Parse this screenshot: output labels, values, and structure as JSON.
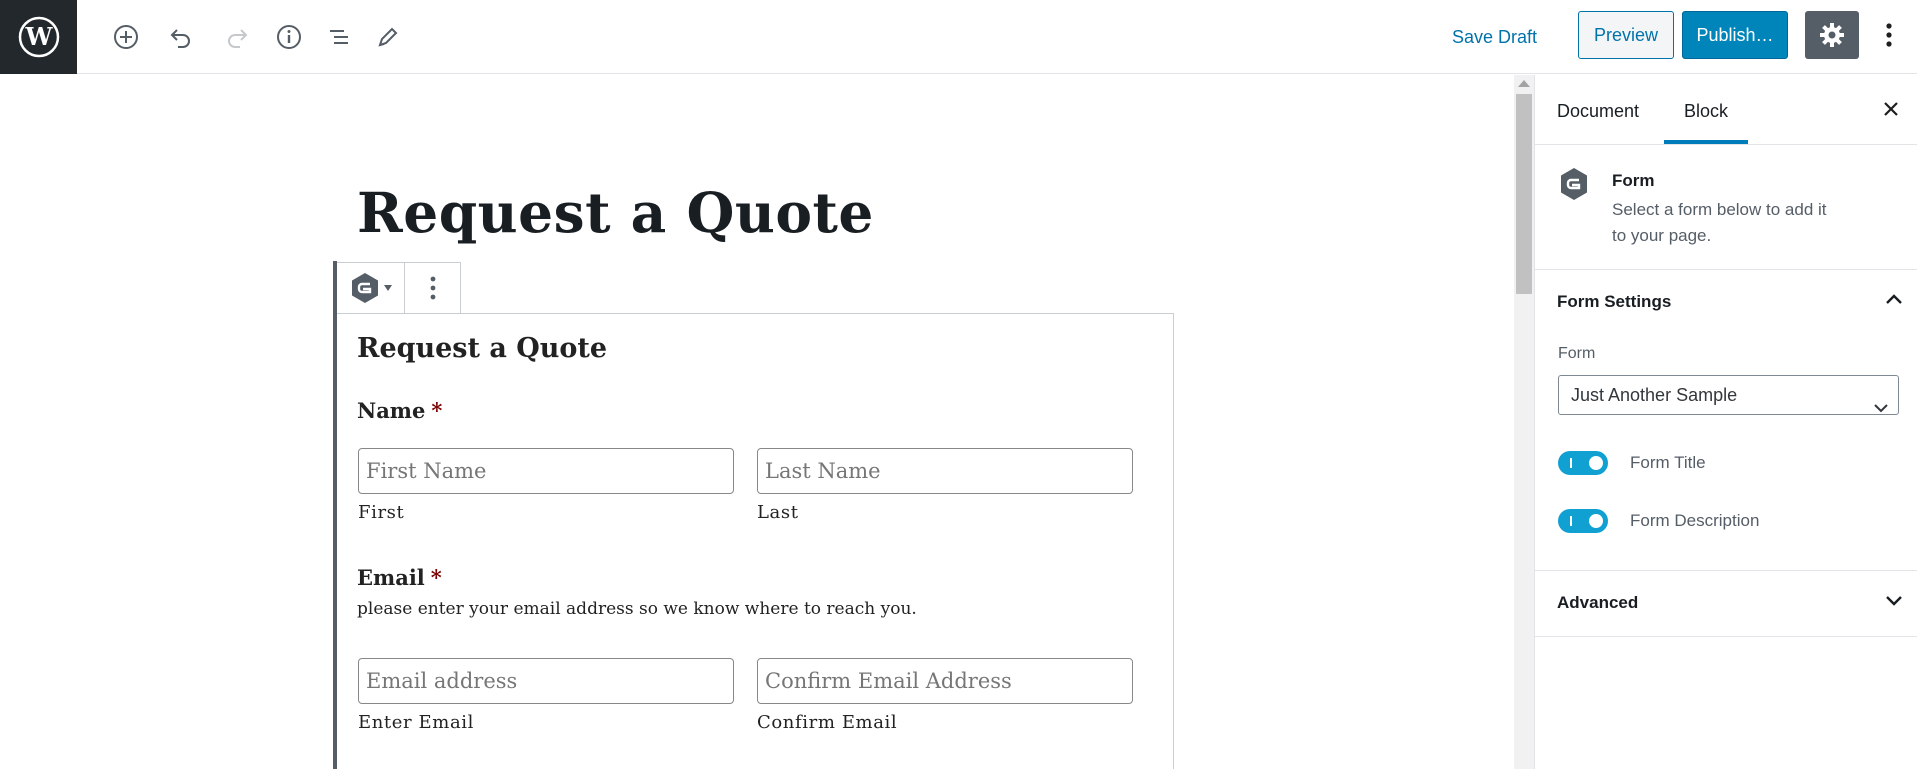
{
  "toolbar": {
    "save_draft_label": "Save Draft",
    "preview_label": "Preview",
    "publish_label": "Publish…",
    "accent_color": "#0073aa",
    "publish_color": "#0085ba"
  },
  "editor": {
    "post_title": "Request a Quote",
    "form": {
      "title": "Request a Quote",
      "name_label": "Name",
      "required_mark": "*",
      "first_name_placeholder": "First Name",
      "first_sublabel": "First",
      "last_name_placeholder": "Last Name",
      "last_sublabel": "Last",
      "email_label": "Email",
      "email_description": "please enter your email address so we know where to reach you.",
      "email_placeholder": "Email address",
      "enter_email_sublabel": "Enter Email",
      "confirm_email_placeholder": "Confirm Email Address",
      "confirm_email_sublabel": "Confirm Email"
    }
  },
  "sidebar": {
    "tabs": [
      {
        "label": "Document",
        "active": false
      },
      {
        "label": "Block",
        "active": true
      }
    ],
    "block_card": {
      "title": "Form",
      "description": "Select a form below to add it to your page."
    },
    "form_settings": {
      "title": "Form Settings",
      "expanded": true,
      "form_select_label": "Form",
      "form_select_value": "Just Another Sample",
      "toggles": [
        {
          "label": "Form Title",
          "on": true
        },
        {
          "label": "Form Description",
          "on": true
        }
      ]
    },
    "advanced": {
      "title": "Advanced",
      "expanded": false
    }
  }
}
